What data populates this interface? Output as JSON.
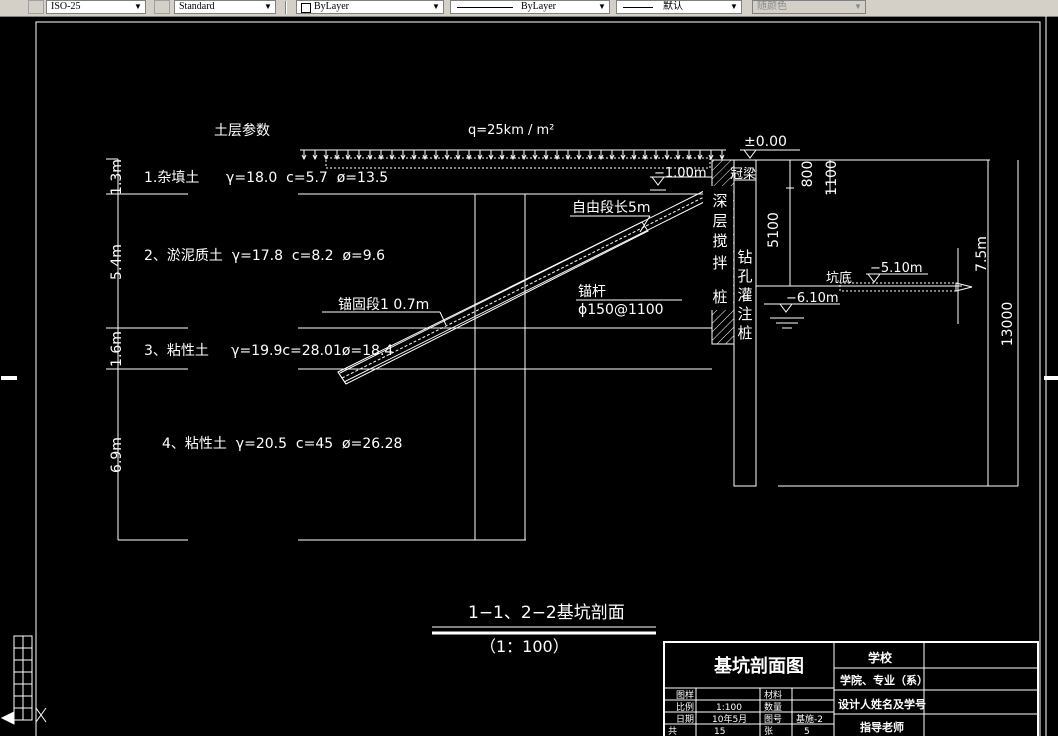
{
  "toolbar": {
    "dimstyle": "ISO-25",
    "tablestyle": "Standard",
    "layer_label": "ByLayer",
    "linetype": "ByLayer",
    "lineweight": "默认",
    "plotstyle": "随颜色"
  },
  "drawing": {
    "soil_params_title": "土层参数",
    "load": "q=25km / m²",
    "layers": [
      "1.杂填土      γ=18.0  c=5.7  ø=13.5",
      "2、淤泥质土  γ=17.8  c=8.2  ø=9.6",
      "3、粘性土     γ=19.9c=28.01ø=18.4",
      "4、粘性土  γ=20.5  c=45  ø=26.28"
    ],
    "thicknesses": [
      "1.3m",
      "5.4m",
      "1.6m",
      "6.9m"
    ],
    "elev_top": "±0.00",
    "crown_beam": "冠梁",
    "water_level": "−1.00m",
    "free_length": "自由段长5m",
    "anchor_fixed": "锚固段1 0.7m",
    "anchor_rod": "锚杆",
    "anchor_spec": "ϕ150@1100",
    "mixing_pile": [
      "深",
      "层",
      "搅",
      "拌",
      "桩"
    ],
    "bored_pile": [
      "钻",
      "孔",
      "灌",
      "注",
      "桩"
    ],
    "dims_vertical": [
      "800",
      "1100",
      "5100",
      "7.5m",
      "13000"
    ],
    "pit_bottom": "坑底",
    "elev_bottom": "−5.10m",
    "elev_water2": "−6.10m",
    "section_title": "1−1、2−2基坑剖面",
    "scale": "（1：100）"
  },
  "titleblock": {
    "title": "基坑剖面图",
    "school": "学校",
    "college": "学院、专业（系）",
    "designer": "设计人姓名及学号",
    "advisor": "指导老师",
    "drawing_label": "图样",
    "scale_label": "比例",
    "scale_value": "1:100",
    "date_label": "日期",
    "date_value": "10年5月",
    "total_label": "共",
    "total_value": "15",
    "material_label": "材料",
    "quantity_label": "数量",
    "sheet_no_label": "图号",
    "sheet_no_value": "基施-2",
    "page_label": "张",
    "page_value": "5"
  },
  "colors": {
    "line": "#ffffff",
    "bg": "#000000",
    "toolbar": "#d4d0c8"
  }
}
